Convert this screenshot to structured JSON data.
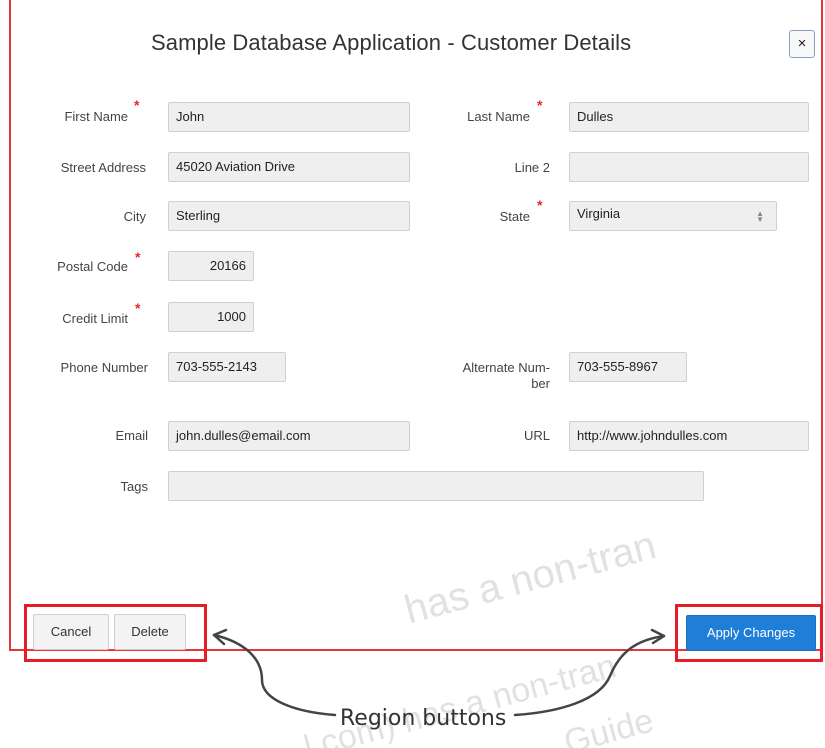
{
  "dialog": {
    "title": "Sample Database Application - Customer Details",
    "close_label": "×"
  },
  "form": {
    "first_name": {
      "label": "First Name",
      "value": "John",
      "required": true
    },
    "last_name": {
      "label": "Last Name",
      "value": "Dulles",
      "required": true
    },
    "street_address": {
      "label": "Street Address",
      "value": "45020 Aviation Drive",
      "required": false
    },
    "line2": {
      "label": "Line 2",
      "value": "",
      "required": false
    },
    "city": {
      "label": "City",
      "value": "Sterling",
      "required": false
    },
    "state": {
      "label": "State",
      "value": "Virginia",
      "required": true
    },
    "postal_code": {
      "label": "Postal Code",
      "value": "20166",
      "required": true
    },
    "credit_limit": {
      "label": "Credit Limit",
      "value": "1000",
      "required": true
    },
    "phone_number": {
      "label": "Phone Number",
      "value": "703-555-2143",
      "required": false
    },
    "alternate_number": {
      "label_line1": "Alternate Num-",
      "label_line2": "ber",
      "value": "703-555-8967",
      "required": false
    },
    "email": {
      "label": "Email",
      "value": "john.dulles@email.com",
      "required": false
    },
    "url": {
      "label": "URL",
      "value": "http://www.johndulles.com",
      "required": false
    },
    "tags": {
      "label": "Tags",
      "value": ""
    },
    "required_marker": "*"
  },
  "buttons": {
    "cancel": "Cancel",
    "delete": "Delete",
    "apply": "Apply Changes"
  },
  "annotation": {
    "text": "Region buttons"
  },
  "watermark": {
    "line1": "has a non-tran",
    "line2": "l.com) has a non-tran",
    "line3": "Guide"
  },
  "colors": {
    "highlight_red": "#e41e26",
    "required_red": "#e4272b",
    "primary_blue": "#1f7ed8",
    "field_bg": "#efefef"
  }
}
